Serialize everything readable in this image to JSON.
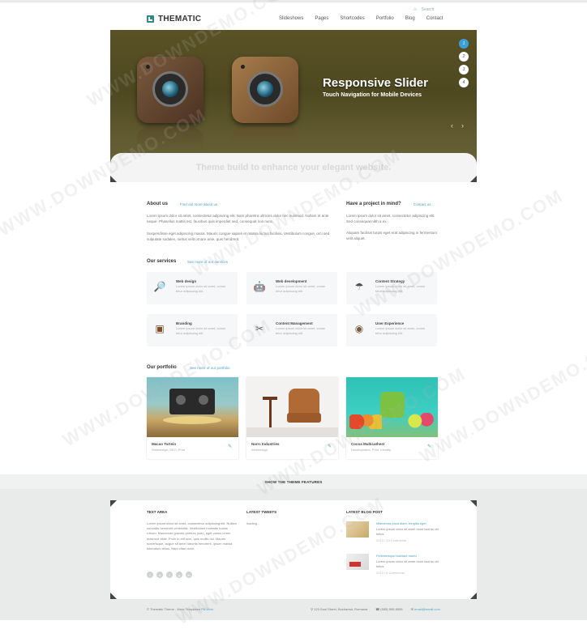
{
  "header": {
    "logo_text": "THEMATIC",
    "util_search": "Search",
    "nav": [
      "Slideshows",
      "Pages",
      "Shortcodes",
      "Portfolio",
      "Blog",
      "Contact"
    ]
  },
  "slider": {
    "title": "Responsive Slider",
    "subtitle": "Touch Navigation for Mobile Devices",
    "dots": [
      "1",
      "2",
      "3",
      "4"
    ],
    "prev_arrow": "‹",
    "next_arrow": "›",
    "tagline": "Theme build to enhance your elegant website."
  },
  "about": {
    "heading": "About us",
    "link": "Find out more about us",
    "p1": "Lorem ipsum dolor sit amet, consectetur adipiscing elit. Nam pharetra ultricies dolor nec euismod. Nullam et ante neque. Phasellus mattis est, faucibus quis imperdiet sed, consequat non nunc.",
    "p2": "Suspendisse eget adipiscing massa. Mauris congue sapien et massa luctus facilisis. Vestibulum congue, orci sed vulputate sodales, metus velit ornare ante, quis hendrerit."
  },
  "project": {
    "heading": "Have a project in mind?",
    "link": "Contact us",
    "p1": "Lorem ipsum dolor sit amet, consectetur adipiscing elit. Sed consequat nibh a ex.",
    "p2": "Aliquam facilisis turpis eget erat adipiscing in fermentum velit aliquet."
  },
  "services": {
    "heading": "Our services",
    "link": "See more of our services",
    "items": [
      {
        "title": "Web design",
        "text": "Lorem ipsum dolor sit amet, conse tetur adipiscing elit.",
        "icon": "🔎"
      },
      {
        "title": "Web development",
        "text": "Lorem ipsum dolor sit amet, conse tetur adipiscing elit.",
        "icon": "🤖"
      },
      {
        "title": "Content Strategy",
        "text": "Lorem ipsum dolor sit amet, conse tetur adipiscing elit.",
        "icon": "☂"
      },
      {
        "title": "Branding",
        "text": "Lorem ipsum dolor sit amet, conse tetur adipiscing elit.",
        "icon": "▣"
      },
      {
        "title": "Content Management",
        "text": "Lorem ipsum dolor sit amet, conse tetur adipiscing elit.",
        "icon": "✂"
      },
      {
        "title": "User Experience",
        "text": "Lorem ipsum dolor sit amet, conse tetur adipiscing elit.",
        "icon": "◉"
      }
    ]
  },
  "portfolio": {
    "heading": "Our portfolio",
    "link": "See more of our portfolio",
    "items": [
      {
        "title": "Macao Tortein",
        "meta": "Webdesign, SEO, Print"
      },
      {
        "title": "Narrc Industries",
        "meta": "Webdesign"
      },
      {
        "title": "Cocoa Multicathest",
        "meta": "Development, Print, Identity"
      }
    ]
  },
  "features_bar": "SHOW THE THEME FEATURES",
  "footer": {
    "text_area": {
      "heading": "TEXT AREA",
      "text": "Lorem ipsum dolor sit amet, consectetur adipiscing elit. Nullam convallis hendrerit venenatis. Vestibulum molestie luctus rutrum. Maecenas gravida pretium justo, eget varius lorem euismod vitae. Proin in elit sem, quis mollis dui. Mauris scelerisque, augue sit amet lobortis hendrerit, ipsum massa bibendum tellus. Nam vitae dolor.",
      "social": [
        "t",
        "d",
        "f",
        "g",
        "in"
      ]
    },
    "tweets": {
      "heading": "LATEST TWEETS",
      "loading": "loading..."
    },
    "blog": {
      "heading": "LATEST BLOG POST",
      "posts": [
        {
          "title": "Maecenas justo diam, fringilla eget",
          "excerpt": "Lorem ipsum dolor sit amet dolor lacinia vel tellus.",
          "meta": "2013 / 10 Comments"
        },
        {
          "title": "Pellentesque habitant morbi",
          "excerpt": "Lorem ipsum dolor sit amet dolor lacinia vel tellus.",
          "meta": "2013 / 8 Comments"
        }
      ]
    }
  },
  "bottom_bar": {
    "copyright": "© Thematic Theme - More Templates",
    "copyright_link": "Pik Web",
    "address": "123 Soul Street, Bucharest, Romania",
    "phone": "(555) 555-5555",
    "email": "email@email.com"
  },
  "watermark": "WWW.DOWNDEMO.COM"
}
